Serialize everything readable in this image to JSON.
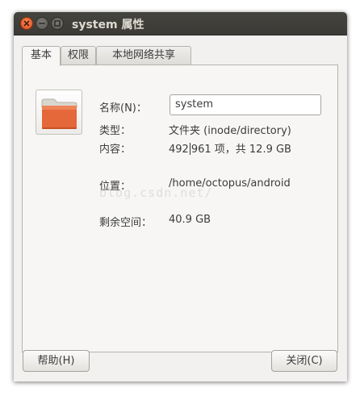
{
  "window": {
    "title": "system 属性"
  },
  "tabs": [
    "基本",
    "权限",
    "本地网络共享"
  ],
  "fields": {
    "name_label": "名称(N)：",
    "name_value": "system",
    "type_label": "类型：",
    "type_value": "文件夹 (inode/directory)",
    "contents_label": "内容：",
    "contents_value_a": "492",
    "contents_value_b": "961 项，共 12.9 GB",
    "location_label": "位置：",
    "location_value": "/home/octopus/android",
    "free_label": "剩余空间：",
    "free_value": "40.9 GB"
  },
  "buttons": {
    "help": "帮助(H)",
    "close": "关闭(C)"
  },
  "watermark": "blog.csdn.net/",
  "colors": {
    "folder": "#e2683a",
    "titlebar": "#3c3b37",
    "close_button": "#e65a24"
  },
  "icons": {
    "folder": "folder-icon",
    "close": "close-icon",
    "minimize": "minimize-icon",
    "maximize": "maximize-icon"
  }
}
